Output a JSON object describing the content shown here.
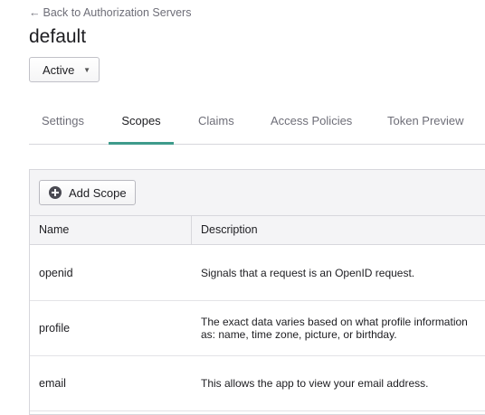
{
  "nav": {
    "back_arrow": "←",
    "back_label": "Back to Authorization Servers"
  },
  "page": {
    "title": "default"
  },
  "status": {
    "selected": "Active",
    "caret": "▼"
  },
  "tabs": [
    {
      "label": "Settings"
    },
    {
      "label": "Scopes"
    },
    {
      "label": "Claims"
    },
    {
      "label": "Access Policies"
    },
    {
      "label": "Token Preview"
    }
  ],
  "active_tab": "Scopes",
  "toolbar": {
    "add_scope_label": "Add Scope",
    "add_icon": "plus-circle-icon"
  },
  "table": {
    "columns": [
      "Name",
      "Description"
    ],
    "rows": [
      {
        "name": "openid",
        "description": "Signals that a request is an OpenID request."
      },
      {
        "name": "profile",
        "description": "The exact data varies based on what profile information\nas: name, time zone, picture, or birthday."
      },
      {
        "name": "email",
        "description": "This allows the app to view your email address."
      }
    ]
  },
  "colors": {
    "accent": "#3f9b8c",
    "border": "#d7d7dc",
    "header_bg": "#f4f4f6"
  }
}
